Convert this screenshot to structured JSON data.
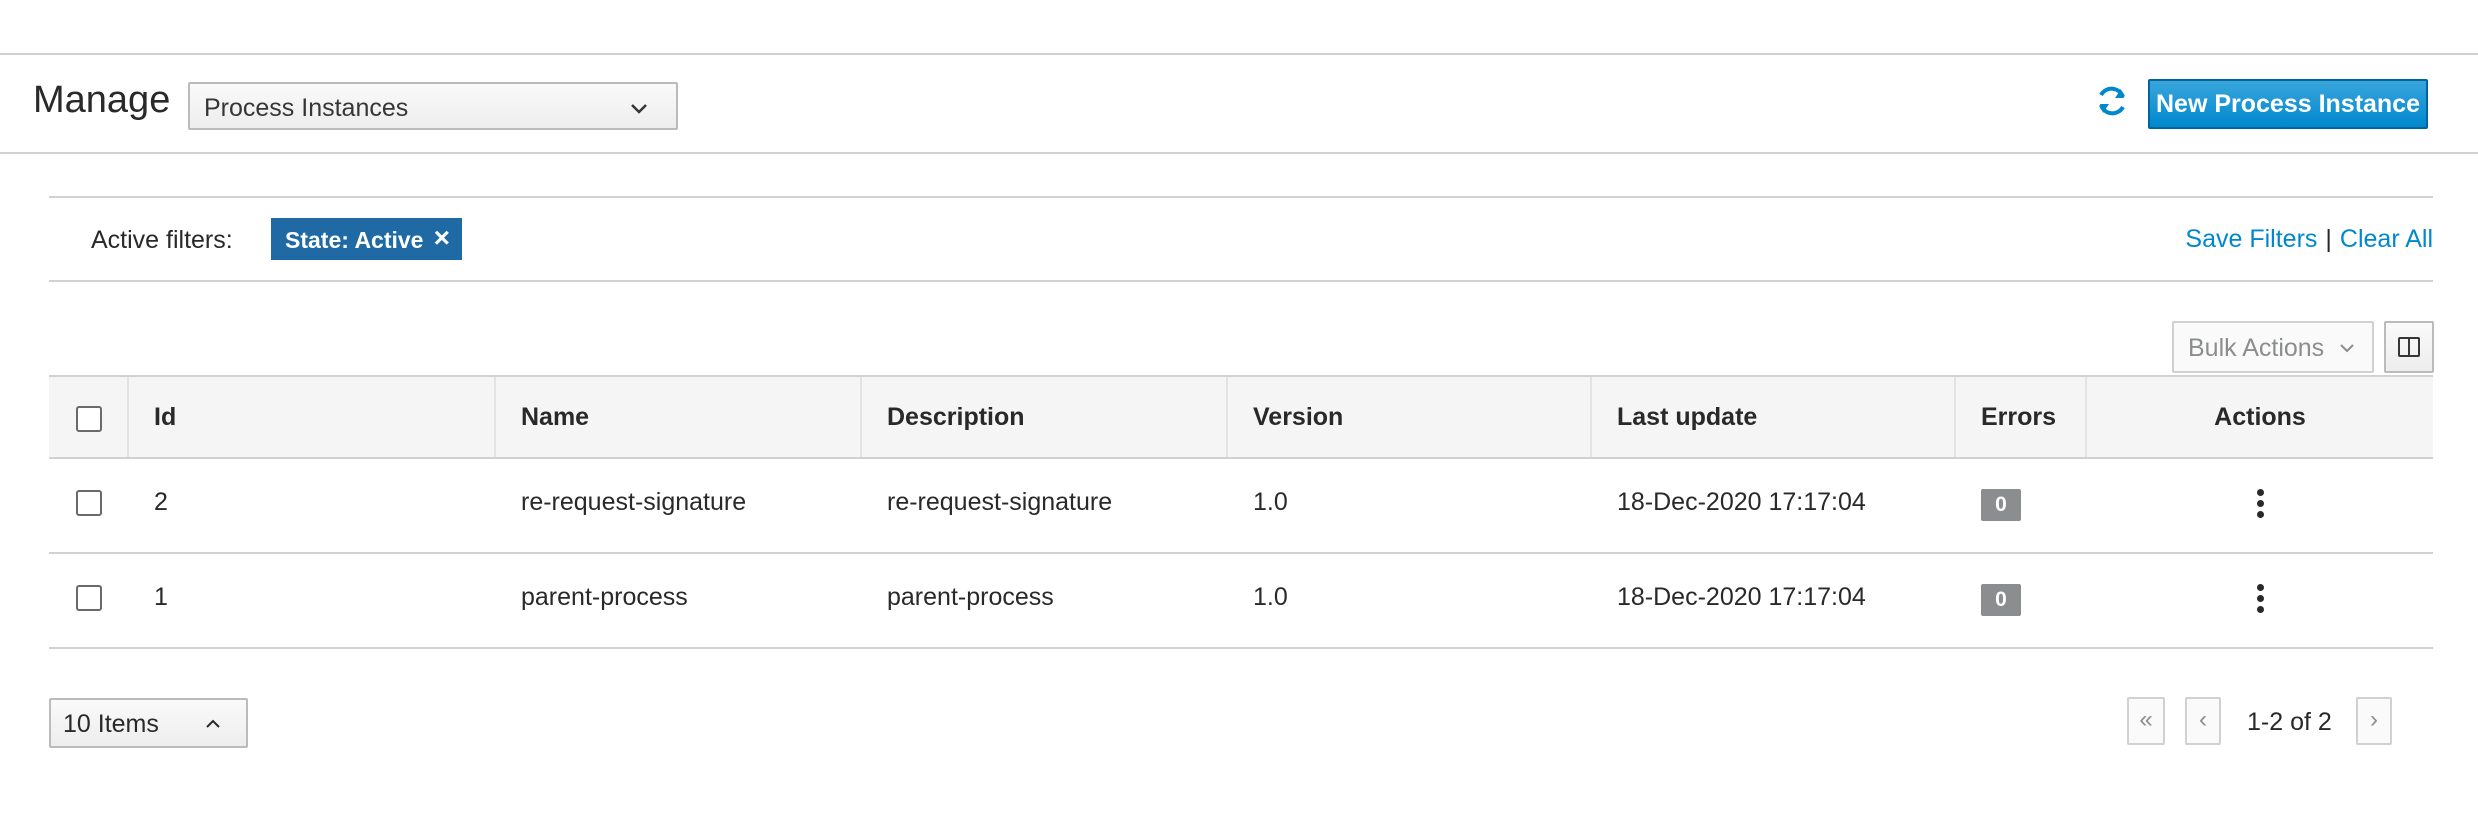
{
  "header": {
    "title": "Manage",
    "view_select": "Process Instances",
    "new_button": "New Process Instance"
  },
  "filters": {
    "label": "Active filters:",
    "chips": [
      {
        "label": "State: Active"
      }
    ],
    "save_link": "Save Filters",
    "separator": "|",
    "clear_link": "Clear All"
  },
  "toolbar": {
    "bulk_actions": "Bulk Actions"
  },
  "table": {
    "columns": [
      "Id",
      "Name",
      "Description",
      "Version",
      "Last update",
      "Errors",
      "Actions"
    ],
    "rows": [
      {
        "id": "2",
        "name": "re-request-signature",
        "description": "re-request-signature",
        "version": "1.0",
        "last_update": "18-Dec-2020 17:17:04",
        "errors": "0"
      },
      {
        "id": "1",
        "name": "parent-process",
        "description": "parent-process",
        "version": "1.0",
        "last_update": "18-Dec-2020 17:17:04",
        "errors": "0"
      }
    ]
  },
  "pagination": {
    "items_per_page": "10 Items",
    "range": "1-2 of 2",
    "first": "«",
    "prev": "‹",
    "next": "›"
  },
  "colors": {
    "accent": "#0088ce",
    "chip": "#1f6aa5",
    "badge": "#8b8d8f"
  }
}
